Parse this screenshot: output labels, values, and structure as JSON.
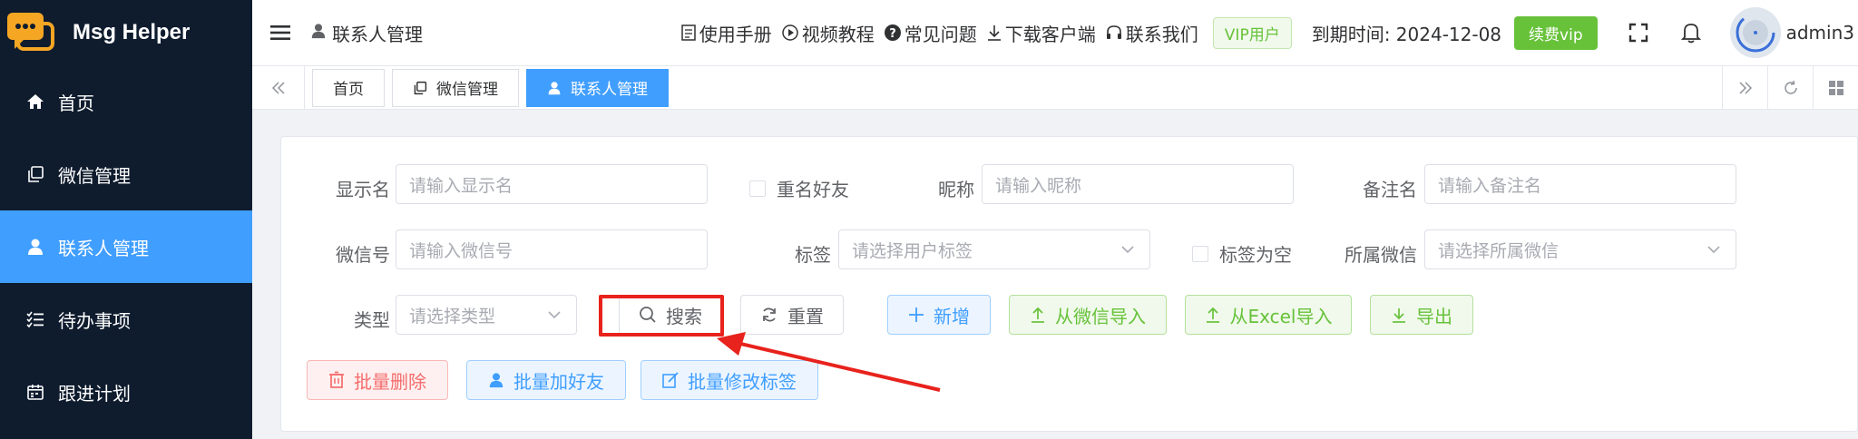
{
  "app": {
    "name": "Msg Helper"
  },
  "sidebar": {
    "items": [
      {
        "label": "首页",
        "icon": "home-icon",
        "active": false
      },
      {
        "label": "微信管理",
        "icon": "copy-icon",
        "active": false
      },
      {
        "label": "联系人管理",
        "icon": "user-icon",
        "active": true
      },
      {
        "label": "待办事项",
        "icon": "checklist-icon",
        "active": false
      },
      {
        "label": "跟进计划",
        "icon": "calendar-icon",
        "active": false
      }
    ]
  },
  "header": {
    "breadcrumb": "联系人管理",
    "links": {
      "manual": "使用手册",
      "video": "视频教程",
      "faq": "常见问题",
      "download": "下载客户端",
      "contact": "联系我们"
    },
    "vip_tag": "VIP用户",
    "expire_label": "到期时间: 2024-12-08",
    "renew_label": "续费vip",
    "username": "admin3"
  },
  "tabs": [
    {
      "label": "首页",
      "active": false
    },
    {
      "label": "微信管理",
      "active": false
    },
    {
      "label": "联系人管理",
      "active": true
    }
  ],
  "filters": {
    "display_name": {
      "label": "显示名",
      "placeholder": "请输入显示名"
    },
    "duplicate_friend": {
      "label": "重名好友"
    },
    "nickname": {
      "label": "昵称",
      "placeholder": "请输入昵称"
    },
    "remark": {
      "label": "备注名",
      "placeholder": "请输入备注名"
    },
    "wechat_id": {
      "label": "微信号",
      "placeholder": "请输入微信号"
    },
    "tag": {
      "label": "标签",
      "placeholder": "请选择用户标签"
    },
    "tag_empty": {
      "label": "标签为空"
    },
    "owner_wechat": {
      "label": "所属微信",
      "placeholder": "请选择所属微信"
    },
    "type": {
      "label": "类型",
      "placeholder": "请选择类型"
    }
  },
  "actions": {
    "search": "搜索",
    "reset": "重置",
    "add": "新增",
    "import_wechat": "从微信导入",
    "import_excel": "从Excel导入",
    "export": "导出",
    "batch_delete": "批量删除",
    "batch_add_friend": "批量加好友",
    "batch_edit_tag": "批量修改标签"
  },
  "colors": {
    "sidebar_bg": "#0f1c2e",
    "primary": "#409eff",
    "success": "#67c23a",
    "danger": "#f56c6c",
    "annotation": "#e8221c"
  }
}
